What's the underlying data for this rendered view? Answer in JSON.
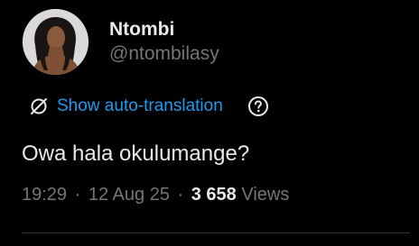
{
  "user": {
    "display_name": "Ntombi",
    "handle": "@ntombilasy"
  },
  "translation": {
    "label": "Show auto-translation",
    "icon": "translate-off-icon",
    "help_icon": "question-circle-icon"
  },
  "tweet": {
    "text": "Owa hala okulumange?"
  },
  "meta": {
    "time": "19:29",
    "separator": "·",
    "date": "12 Aug 25",
    "views_count": "3 658",
    "views_label": "Views"
  },
  "colors": {
    "background": "#000000",
    "text_primary": "#e7e9ea",
    "text_secondary": "#71767b",
    "accent": "#1d9bf0",
    "divider": "#2f3336"
  }
}
